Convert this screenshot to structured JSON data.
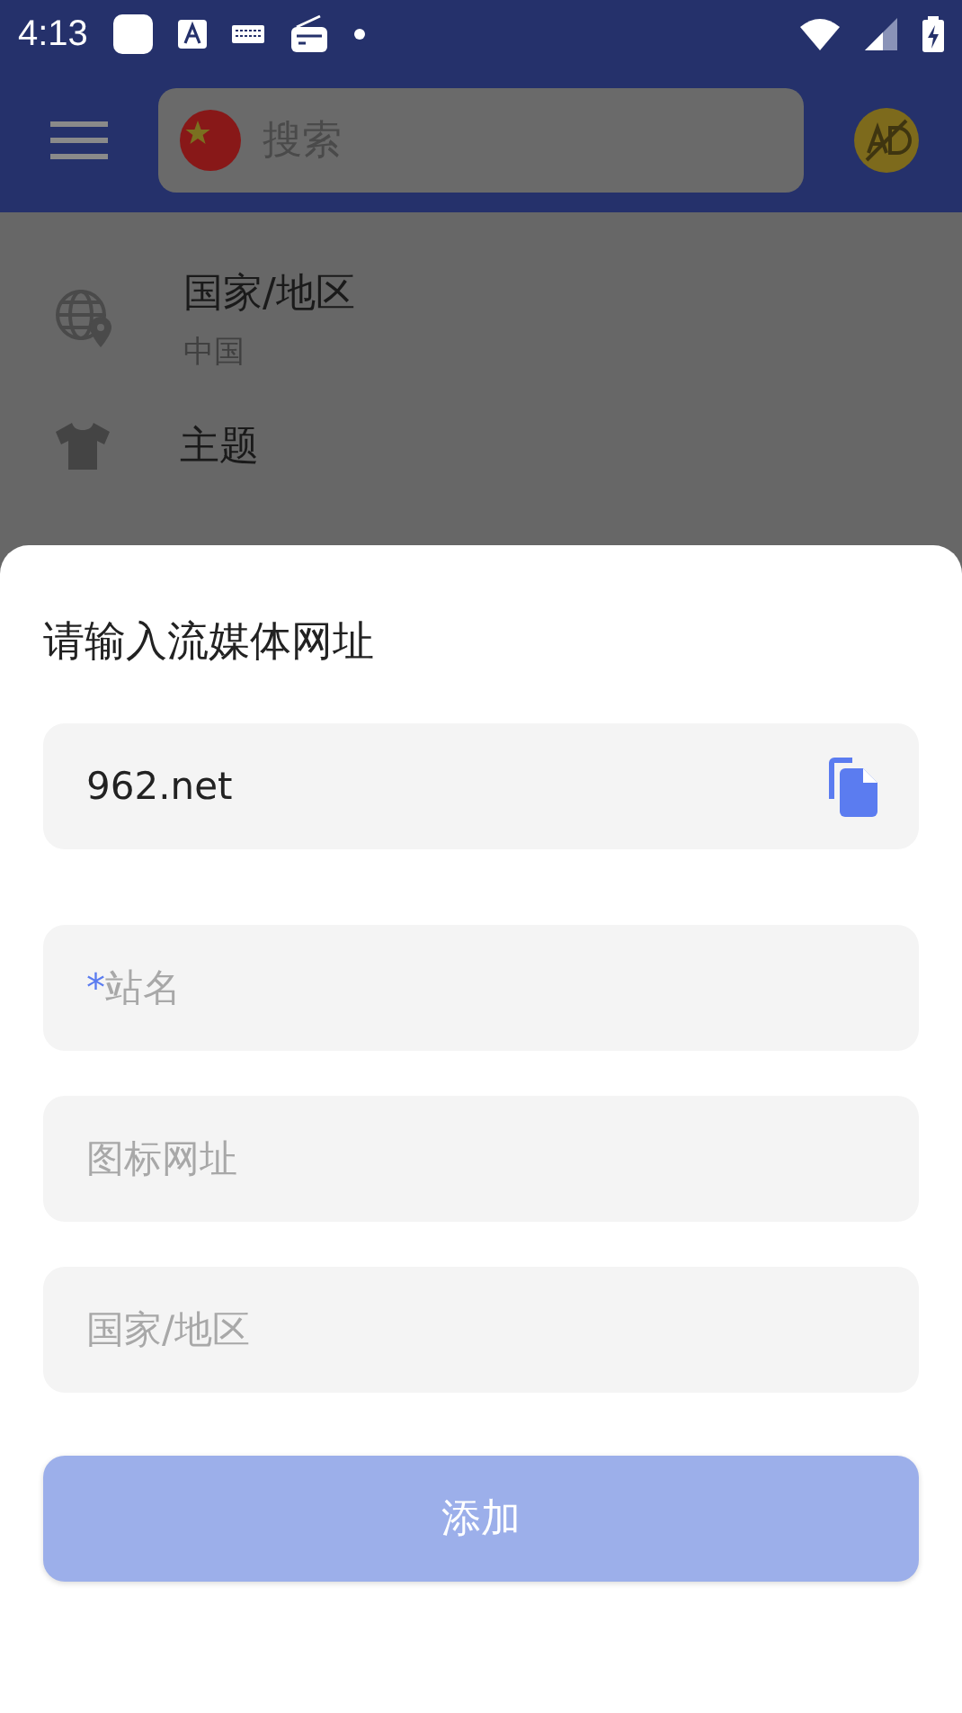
{
  "status_bar": {
    "time": "4:13"
  },
  "app_bar": {
    "search": {
      "placeholder": "搜索"
    }
  },
  "settings": [
    {
      "kind": "globe",
      "title": "国家/地区",
      "subtitle": "中国"
    },
    {
      "kind": "shirt",
      "title": "主题"
    }
  ],
  "sheet": {
    "title": "请输入流媒体网址",
    "url_field": {
      "value": "962.net"
    },
    "fields": [
      {
        "required_mark": "*",
        "placeholder": "站名"
      },
      {
        "placeholder": "图标网址"
      },
      {
        "placeholder": "国家/地区"
      }
    ],
    "submit": {
      "label": "添加",
      "disabled": true
    }
  }
}
